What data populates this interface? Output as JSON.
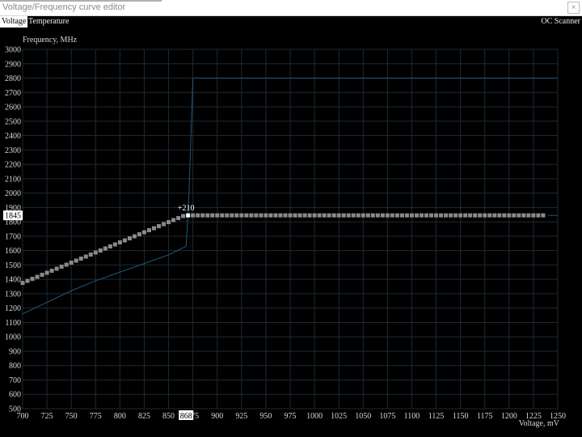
{
  "window": {
    "title": "Voltage/Frequency curve editor",
    "close_icon": "close-icon"
  },
  "tabs": [
    {
      "label": "Voltage",
      "active": true
    },
    {
      "label": "Temperature",
      "active": false
    }
  ],
  "right_tab": {
    "label": "OC Scanner"
  },
  "colors": {
    "background": "#000000",
    "grid": "#1c2a36",
    "default_curve": "#1c5a7e",
    "points": "#8a8a8a",
    "cursor": "#ffffff"
  },
  "chart_data": {
    "type": "line",
    "ylabel": "Frequency, MHz",
    "xlabel": "Voltage, mV",
    "xlim": [
      700,
      1250
    ],
    "ylim": [
      500,
      3000
    ],
    "xticks": [
      700,
      725,
      750,
      775,
      800,
      825,
      850,
      875,
      900,
      925,
      950,
      975,
      1000,
      1025,
      1050,
      1075,
      1100,
      1125,
      1150,
      1175,
      1200,
      1225,
      1250
    ],
    "yticks": [
      500,
      600,
      700,
      800,
      900,
      1000,
      1100,
      1200,
      1300,
      1400,
      1500,
      1600,
      1700,
      1800,
      1900,
      2000,
      2100,
      2200,
      2300,
      2400,
      2500,
      2600,
      2700,
      2800,
      2900,
      3000
    ],
    "grid": true,
    "cursor": {
      "voltage": 868,
      "voltage_label": "868",
      "frequency": 1845,
      "frequency_label": "1845",
      "offset_label": "+210"
    },
    "series": [
      {
        "role": "default-curve",
        "points": [
          [
            700,
            1160
          ],
          [
            725,
            1240
          ],
          [
            750,
            1320
          ],
          [
            775,
            1390
          ],
          [
            800,
            1450
          ],
          [
            825,
            1510
          ],
          [
            850,
            1570
          ],
          [
            862,
            1610
          ],
          [
            868,
            1630
          ],
          [
            871,
            2000
          ],
          [
            875,
            2800
          ],
          [
            1250,
            2800
          ]
        ]
      },
      {
        "role": "edited-curve",
        "voltage_start": 700,
        "voltage_step": 5,
        "count": 108,
        "frequency_start": 1375,
        "frequency_step": 14.1,
        "frequency_cap": 1845
      }
    ],
    "series_lower_tail": [
      [
        1240,
        1845
      ],
      [
        1250,
        1845
      ]
    ]
  }
}
